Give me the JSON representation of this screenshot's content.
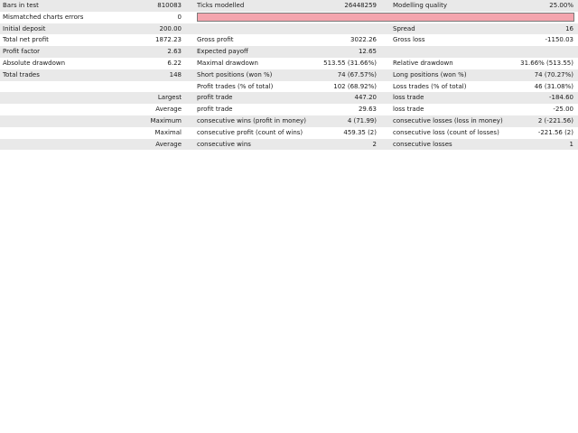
{
  "report": {
    "bars_in_test": {
      "label": "Bars in test",
      "value": "810083"
    },
    "ticks_modelled": {
      "label": "Ticks modelled",
      "value": "26448259"
    },
    "modelling_quality": {
      "label": "Modelling quality",
      "value": "25.00%"
    },
    "mismatched_errors": {
      "label": "Mismatched charts errors",
      "value": "0"
    },
    "quality_bar": {
      "color": "#f4a5ae",
      "quality_fraction": 0.25
    },
    "initial_deposit": {
      "label": "Initial deposit",
      "value": "200.00"
    },
    "spread": {
      "label": "Spread",
      "value": "16"
    },
    "total_net_profit": {
      "label": "Total net profit",
      "value": "1872.23"
    },
    "gross_profit": {
      "label": "Gross profit",
      "value": "3022.26"
    },
    "gross_loss": {
      "label": "Gross loss",
      "value": "-1150.03"
    },
    "profit_factor": {
      "label": "Profit factor",
      "value": "2.63"
    },
    "expected_payoff": {
      "label": "Expected payoff",
      "value": "12.65"
    },
    "absolute_drawdown": {
      "label": "Absolute drawdown",
      "value": "6.22"
    },
    "maximal_drawdown": {
      "label": "Maximal drawdown",
      "value": "513.55 (31.66%)"
    },
    "relative_drawdown": {
      "label": "Relative drawdown",
      "value": "31.66% (513.55)"
    },
    "total_trades": {
      "label": "Total trades",
      "value": "148"
    },
    "short_positions": {
      "label": "Short positions (won %)",
      "value": "74 (67.57%)"
    },
    "long_positions": {
      "label": "Long positions (won %)",
      "value": "74 (70.27%)"
    },
    "profit_trades": {
      "label": "Profit trades (% of total)",
      "value": "102 (68.92%)"
    },
    "loss_trades": {
      "label": "Loss trades (% of total)",
      "value": "46 (31.08%)"
    },
    "largest": {
      "label": "Largest",
      "profit_label": "profit trade",
      "profit_value": "447.20",
      "loss_label": "loss trade",
      "loss_value": "-184.60"
    },
    "average": {
      "label": "Average",
      "profit_label": "profit trade",
      "profit_value": "29.63",
      "loss_label": "loss trade",
      "loss_value": "-25.00"
    },
    "maximum": {
      "label": "Maximum",
      "wins_label": "consecutive wins (profit in money)",
      "wins_value": "4 (71.99)",
      "losses_label": "consecutive losses (loss in money)",
      "losses_value": "2 (-221.56)"
    },
    "maximal": {
      "label": "Maximal",
      "profit_label": "consecutive profit (count of wins)",
      "profit_value": "459.35 (2)",
      "loss_label": "consecutive loss (count of losses)",
      "loss_value": "-221.56 (2)"
    },
    "average_consecutive": {
      "label": "Average",
      "wins_label": "consecutive wins",
      "wins_value": "2",
      "losses_label": "consecutive losses",
      "losses_value": "1"
    }
  }
}
